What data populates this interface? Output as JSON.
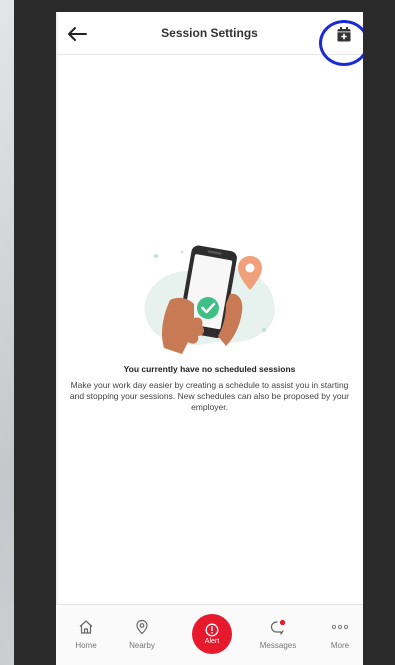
{
  "header": {
    "title": "Session Settings",
    "back_icon": "arrow-left-icon",
    "calendar_icon": "calendar-add-icon"
  },
  "empty_state": {
    "title": "You currently have no scheduled sessions",
    "description": "Make your work day easier by creating a schedule to assist you in starting and stopping your sessions. New schedules can also be proposed by your employer."
  },
  "nav": {
    "items": [
      {
        "label": "Home",
        "icon": "home-icon"
      },
      {
        "label": "Nearby",
        "icon": "location-pin-icon"
      },
      {
        "label": "Alert",
        "icon": "alert-icon"
      },
      {
        "label": "Messages",
        "icon": "message-icon"
      },
      {
        "label": "More",
        "icon": "more-dots-icon"
      }
    ]
  },
  "colors": {
    "alert_red": "#e6192d",
    "highlight_blue": "#1a2bd6",
    "check_green": "#3fbf86",
    "pin_orange": "#f0a07a",
    "hand_skin": "#c87a55"
  }
}
